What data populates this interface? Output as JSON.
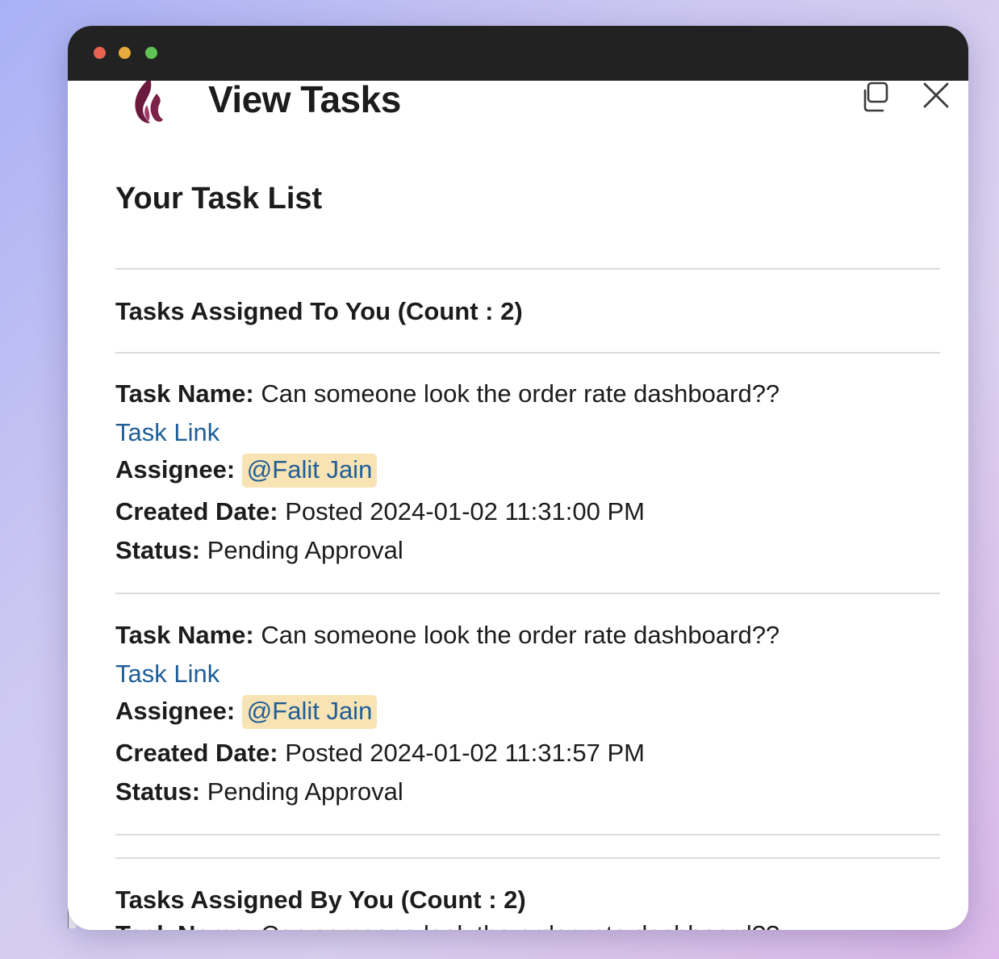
{
  "modal": {
    "title": "View Tasks",
    "copy_icon": "copy-icon",
    "close_icon": "close-icon",
    "logo_icon": "flame-logo-icon"
  },
  "page": {
    "heading": "Your Task List"
  },
  "assigned_to_you": {
    "heading": "Tasks Assigned To You (Count : 2)",
    "tasks": [
      {
        "name_label": "Task Name:",
        "name": "Can someone look the order rate dashboard??",
        "link_label": "Task Link",
        "assignee_label": "Assignee:",
        "assignee": "@Falit Jain",
        "created_label": "Created Date:",
        "created": "Posted 2024-01-02 11:31:00 PM",
        "status_label": "Status:",
        "status": "Pending Approval"
      },
      {
        "name_label": "Task Name:",
        "name": "Can someone look the order rate dashboard??",
        "link_label": "Task Link",
        "assignee_label": "Assignee:",
        "assignee": "@Falit Jain",
        "created_label": "Created Date:",
        "created": "Posted 2024-01-02 11:31:57 PM",
        "status_label": "Status:",
        "status": "Pending Approval"
      }
    ]
  },
  "assigned_by_you": {
    "heading": "Tasks Assigned By You (Count : 2)",
    "next_task_label": "Task Name:",
    "next_task_name": "Can someone look the order rate dashboard??"
  },
  "colors": {
    "link": "#1f5e97",
    "mention_bg": "#f8e3b5",
    "titlebar": "#222222",
    "logo": "#6b1a3d"
  }
}
